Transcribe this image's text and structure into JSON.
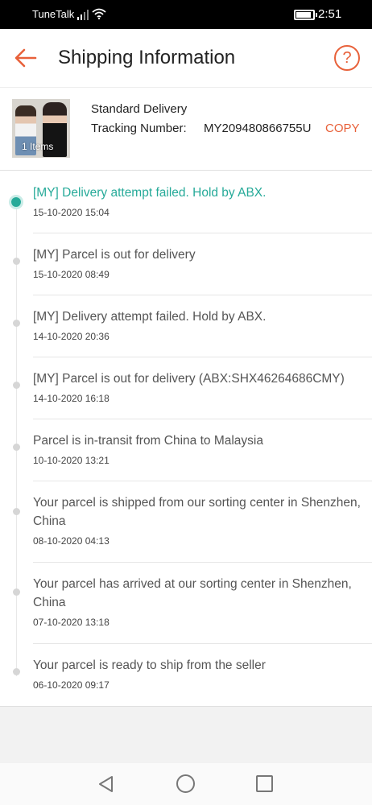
{
  "status_bar": {
    "carrier": "TuneTalk",
    "time": "2:51",
    "battery_level": 0.9
  },
  "header": {
    "title": "Shipping Information",
    "back_icon": "arrow-left-icon",
    "help_icon": "question-circle-icon",
    "accent_color": "#e8613a"
  },
  "summary": {
    "item_count": "1 Items",
    "delivery_method": "Standard Delivery",
    "tracking_label": "Tracking Number:",
    "tracking_number": "MY209480866755U",
    "copy_label": "COPY"
  },
  "timeline": {
    "active_color": "#26aa99",
    "events": [
      {
        "description": "[MY] Delivery attempt failed. Hold by ABX.",
        "time": "15-10-2020 15:04",
        "active": true
      },
      {
        "description": "[MY] Parcel is out for delivery",
        "time": "15-10-2020 08:49",
        "active": false
      },
      {
        "description": "[MY] Delivery attempt failed. Hold by ABX.",
        "time": "14-10-2020 20:36",
        "active": false
      },
      {
        "description": "[MY] Parcel is out for delivery (ABX:SHX46264686CMY)",
        "time": "14-10-2020 16:18",
        "active": false
      },
      {
        "description": "Parcel is in-transit from China to Malaysia",
        "time": "10-10-2020 13:21",
        "active": false
      },
      {
        "description": "Your parcel is shipped from our sorting center in Shenzhen, China",
        "time": "08-10-2020 04:13",
        "active": false
      },
      {
        "description": "Your parcel has arrived at our sorting center in Shenzhen, China",
        "time": "07-10-2020 13:18",
        "active": false
      },
      {
        "description": "Your parcel is ready to ship from the seller",
        "time": "06-10-2020 09:17",
        "active": false
      }
    ]
  },
  "nav_bar": {
    "icons": [
      "triangle-back-icon",
      "circle-home-icon",
      "square-recents-icon"
    ]
  }
}
